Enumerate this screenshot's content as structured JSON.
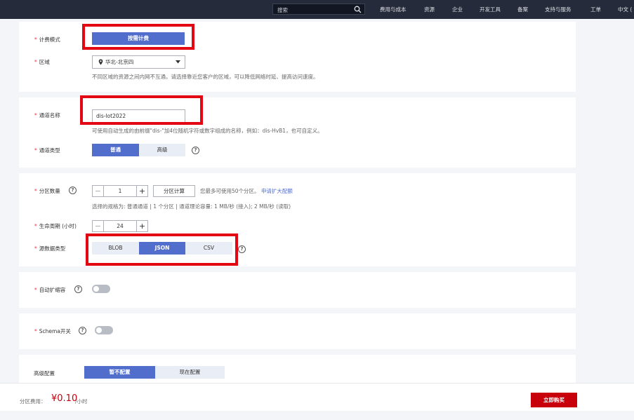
{
  "topbar": {
    "search_placeholder": "搜索",
    "nav": [
      "费用与成本",
      "资源",
      "企业",
      "开发工具",
      "备案",
      "支持与服务",
      "工单",
      "中文 ("
    ]
  },
  "billing": {
    "mode_label": "计费模式",
    "mode_value": "按需计费",
    "region_label": "区域",
    "region_value": "华北-北京四",
    "region_hint": "不同区域的资源之间内网不互通。请选择靠近您客户的区域，可以降低网络时延、提高访问速度。"
  },
  "channel": {
    "name_label": "通道名称",
    "name_value": "dis-lot2022",
    "name_hint": "可使用自动生成的由前缀\"dis-\"加4位随机字符或数字组成的名称，例如：dis-HvB1，也可自定义。",
    "type_label": "通道类型",
    "type_options": [
      "普通",
      "高级"
    ],
    "type_selected": "普通"
  },
  "partition": {
    "count_label": "分区数量",
    "count_value": "1",
    "calc_button": "分区计算",
    "count_hint": "您最多可使用50个分区。",
    "count_link": "申请扩大配额",
    "spec_hint": "选择的规格为: 普通通道 | 1 个分区 | 通道理论容量: 1 MB/秒 (接入); 2 MB/秒 (读取)",
    "lifecycle_label": "生命周期 (小时)",
    "lifecycle_value": "24",
    "source_label": "源数据类型",
    "source_options": [
      "BLOB",
      "JSON",
      "CSV"
    ],
    "source_selected": "JSON"
  },
  "autoscale": {
    "label": "自动扩缩容",
    "enabled": false
  },
  "schema": {
    "label": "Schema开关",
    "enabled": false
  },
  "advanced": {
    "label": "高级配置",
    "options": [
      "暂不配置",
      "现在配置"
    ],
    "selected": "暂不配置"
  },
  "footer": {
    "fee_label": "分区费用：",
    "fee_value": "¥0.10",
    "fee_unit": "/小时",
    "buy_button": "立即购买"
  },
  "colors": {
    "primary": "#526ecc",
    "danger": "#c7000b",
    "highlight_box": "#e30613",
    "topbar": "#252b3a"
  }
}
